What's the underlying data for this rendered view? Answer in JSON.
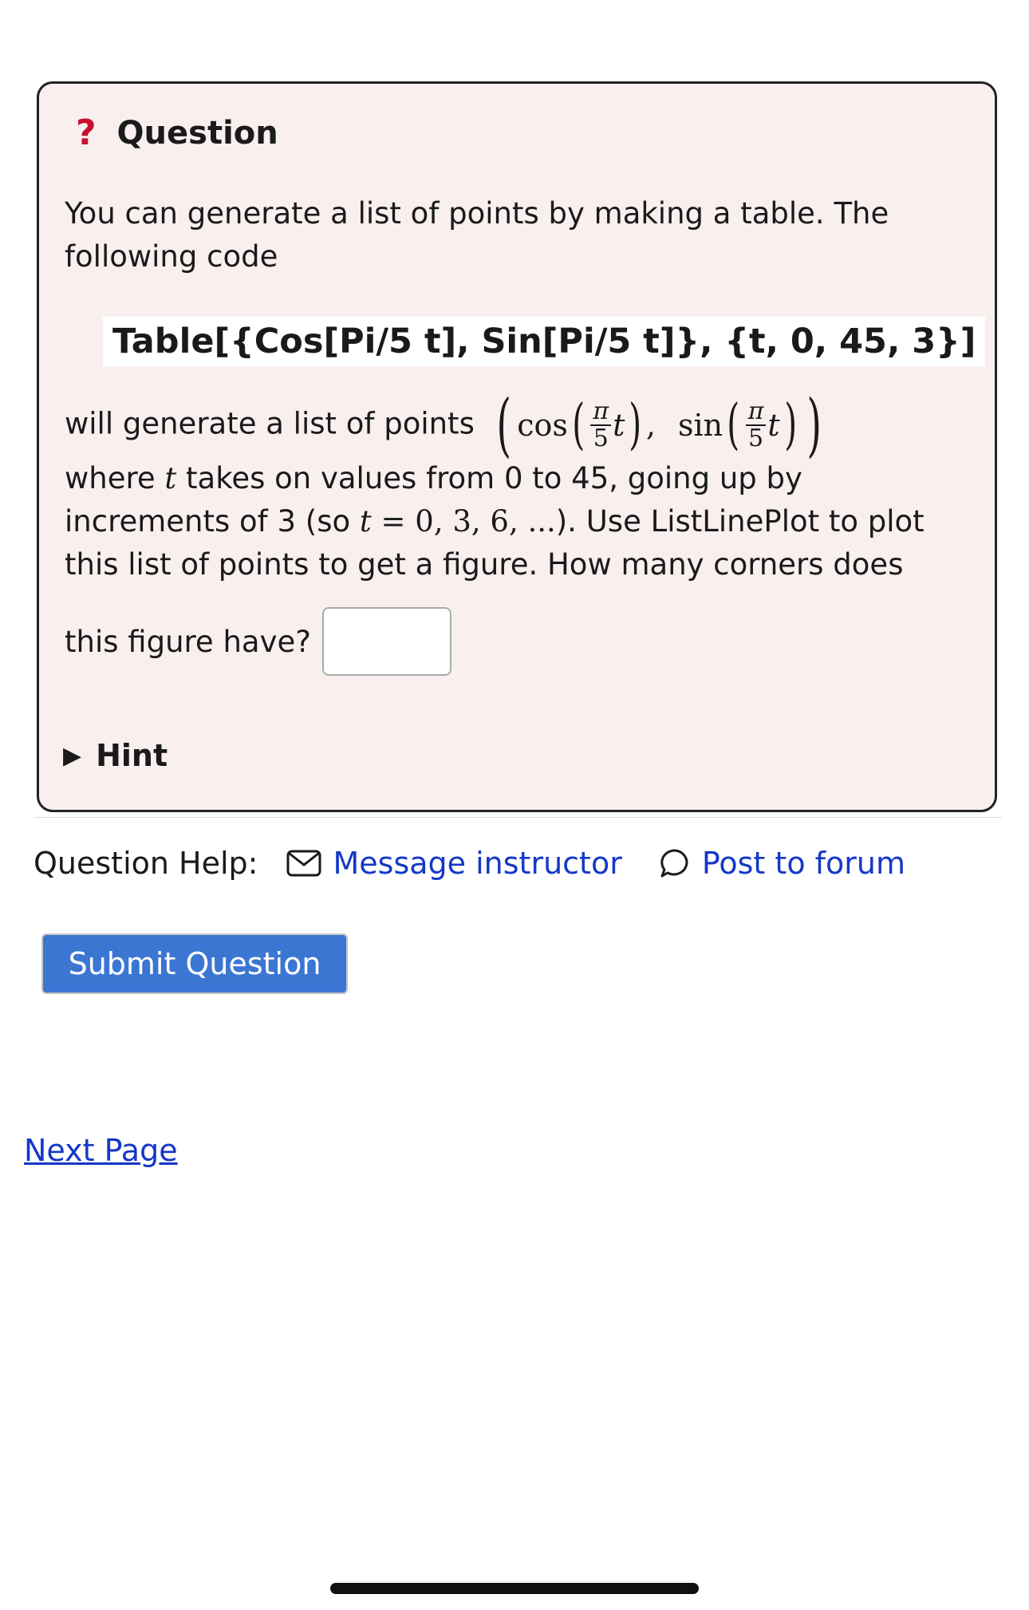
{
  "question": {
    "icon": "?",
    "icon_name": "question-mark-icon",
    "title": "Question",
    "intro": "You can generate a list of points by making a table. The following code",
    "code": "Table[{Cos[Pi/5 t], Sin[Pi/5 t]}, {t, 0, 45, 3}]",
    "formula_prefix": "will generate a list of points",
    "formula": {
      "cos": "cos",
      "sin": "sin",
      "pi": "π",
      "five": "5",
      "t": "t",
      "comma": ","
    },
    "where_a": "where ",
    "where_t": "t",
    "where_b": " takes on values from 0 to 45, going up by increments of 3 (so ",
    "where_t2": "t",
    "where_math": " = 0, 3, 6, ...",
    "where_c": "). Use ListLinePlot to plot this list of points to get a figure. How many corners does",
    "answer_label": "this figure have?",
    "answer_value": "",
    "hint_label": "Hint"
  },
  "help": {
    "label": "Question Help:",
    "message_label": "Message instructor",
    "forum_label": "Post to forum"
  },
  "submit_label": "Submit Question",
  "next_label": "Next Page",
  "colors": {
    "box_bg": "#f9efef",
    "question_icon": "#c8102e",
    "link": "#1538c8",
    "submit_bg": "#3b76d3"
  }
}
